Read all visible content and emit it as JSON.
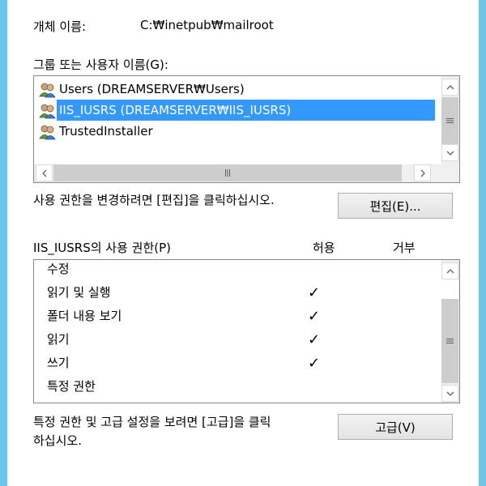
{
  "object_name": {
    "label": "개체 이름:",
    "value": "C:₩inetpub₩mailroot"
  },
  "groups": {
    "label": "그룹 또는 사용자 이름(G):",
    "items": [
      {
        "label": "Users (DREAMSERVER₩Users)",
        "selected": false
      },
      {
        "label": "IIS_IUSRS (DREAMSERVER₩IIS_IUSRS)",
        "selected": true
      },
      {
        "label": "TrustedInstaller",
        "selected": false
      }
    ]
  },
  "edit": {
    "prompt": "사용 권한을 변경하려면 [편집]을 클릭하십시오.",
    "button_label": "편집(E)..."
  },
  "permissions": {
    "title": "IIS_IUSRS의 사용 권한(P)",
    "allow_header": "허용",
    "deny_header": "거부",
    "check_glyph": "✓",
    "rows": [
      {
        "name": "수정",
        "allow": false,
        "deny": false
      },
      {
        "name": "읽기 및 실행",
        "allow": true,
        "deny": false
      },
      {
        "name": "폴더 내용 보기",
        "allow": true,
        "deny": false
      },
      {
        "name": "읽기",
        "allow": true,
        "deny": false
      },
      {
        "name": "쓰기",
        "allow": true,
        "deny": false
      },
      {
        "name": "특정 권한",
        "allow": false,
        "deny": false
      }
    ]
  },
  "advanced": {
    "prompt_line1": "특정 권한 및 고급 설정을 보려면 [고급]을 클릭",
    "prompt_line2": "하십시오.",
    "button_label": "고급(V)"
  },
  "colors": {
    "selection": "#3399ff",
    "frame": "#6ac6ea",
    "scroll_track": "#f0f0f0"
  }
}
